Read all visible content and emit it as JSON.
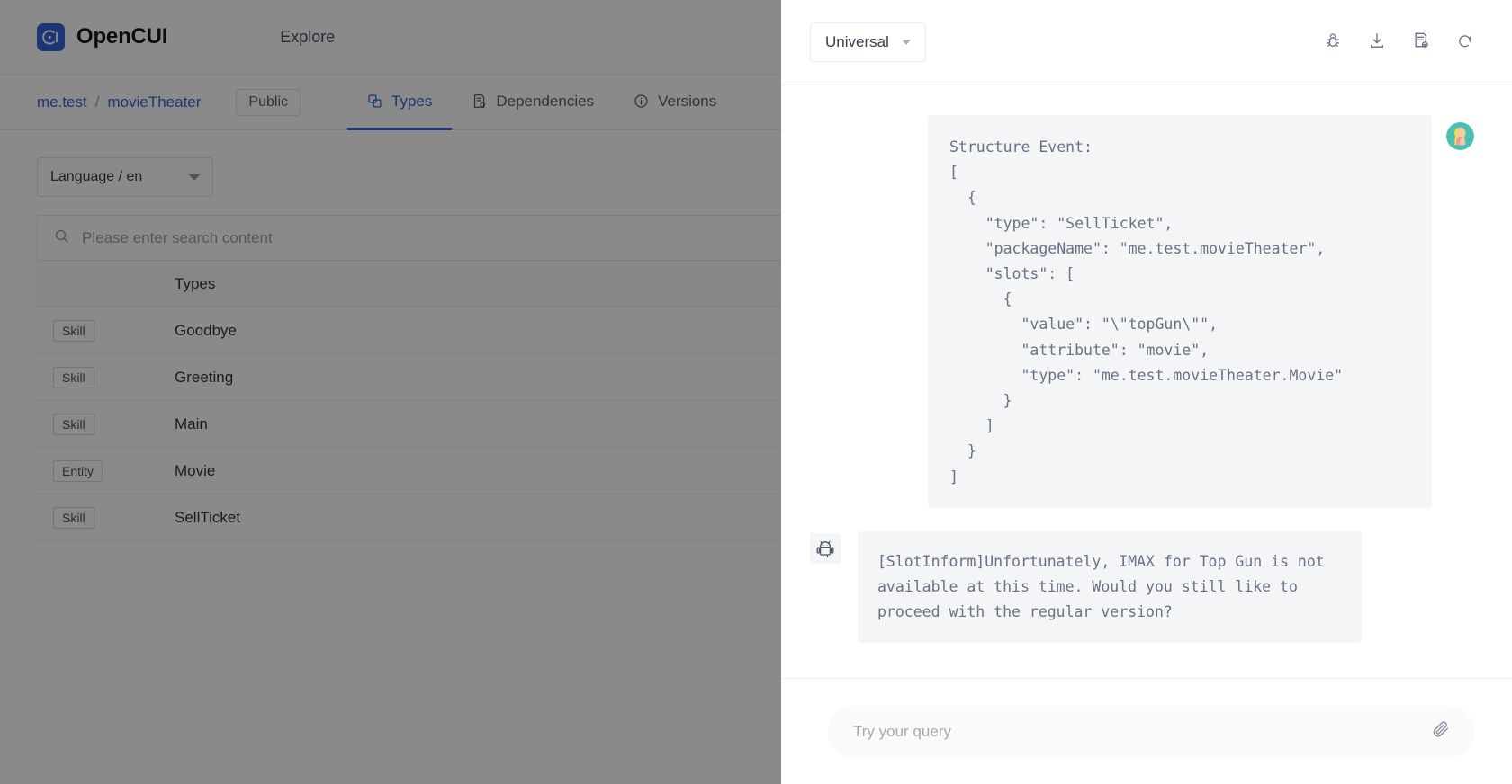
{
  "app": {
    "brand_name": "OpenCUI",
    "nav": {
      "explore": "Explore"
    },
    "breadcrumb": {
      "org": "me.test",
      "sep": "/",
      "project": "movieTheater"
    },
    "visibility_badge": "Public",
    "tabs": [
      {
        "label": "Types",
        "icon": "copy-icon",
        "active": true
      },
      {
        "label": "Dependencies",
        "icon": "list-doc-icon",
        "active": false
      },
      {
        "label": "Versions",
        "icon": "info-icon",
        "active": false
      }
    ],
    "language_select": {
      "value": "Language / en"
    },
    "search": {
      "placeholder": "Please enter search content",
      "icon": "search-icon"
    },
    "table": {
      "columns": [
        "",
        "Types"
      ],
      "rows": [
        {
          "kind": "Skill",
          "name": "Goodbye"
        },
        {
          "kind": "Skill",
          "name": "Greeting"
        },
        {
          "kind": "Skill",
          "name": "Main"
        },
        {
          "kind": "Entity",
          "name": "Movie"
        },
        {
          "kind": "Skill",
          "name": "SellTicket"
        }
      ]
    }
  },
  "chat": {
    "channel_select": {
      "value": "Universal"
    },
    "head_icons": [
      "bug-icon",
      "download-icon",
      "report-check-icon",
      "refresh-icon"
    ],
    "messages": [
      {
        "role": "user",
        "kind": "code",
        "text": "Structure Event:\n[\n  {\n    \"type\": \"SellTicket\",\n    \"packageName\": \"me.test.movieTheater\",\n    \"slots\": [\n      {\n        \"value\": \"\\\"topGun\\\"\",\n        \"attribute\": \"movie\",\n        \"type\": \"me.test.movieTheater.Movie\"\n      }\n    ]\n  }\n]"
      },
      {
        "role": "bot",
        "kind": "text",
        "text": "[SlotInform]Unfortunately, IMAX for Top Gun is not available at this time. Would you still like to proceed with the regular version?"
      }
    ],
    "composer": {
      "placeholder": "Try your query",
      "attach_icon": "paperclip-icon"
    }
  },
  "colors": {
    "accent": "#3563d6",
    "code_bg": "#f4f5f6",
    "code_text": "#6a7086",
    "overlay": "rgba(0,0,0,0.46)"
  }
}
